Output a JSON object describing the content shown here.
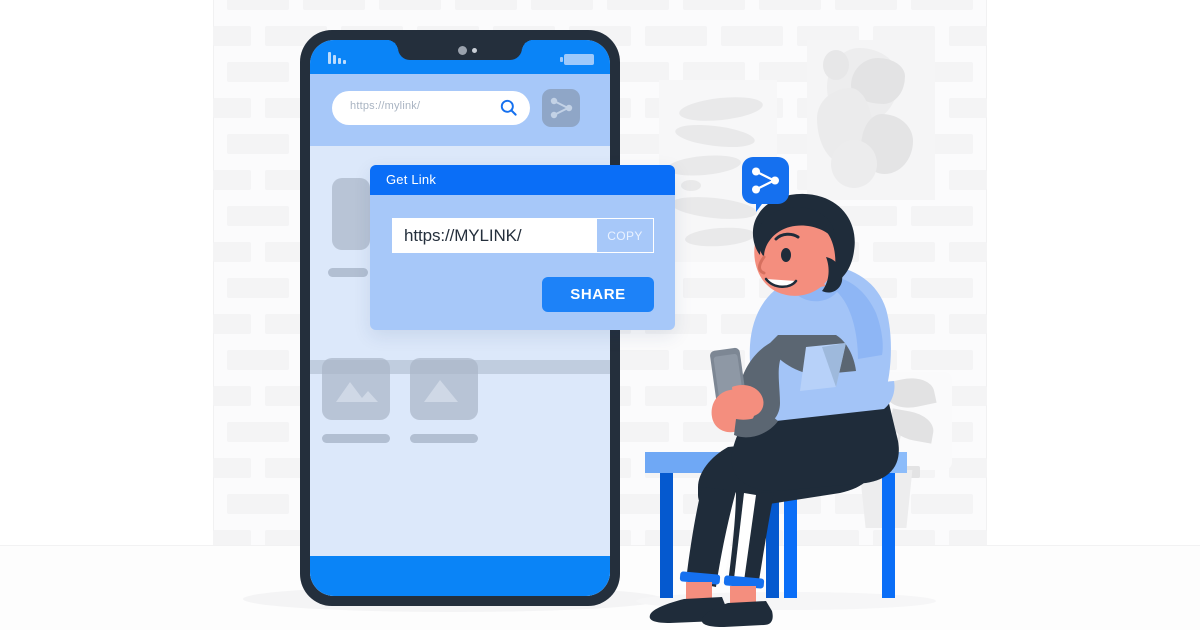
{
  "scene": {
    "title": "Share link illustration",
    "description": "Flat illustration of a woman sitting on a bench using her phone next to a large smartphone showing a Get Link share dialog"
  },
  "phone": {
    "status_bar": {
      "signal_icon": "signal-bars-icon",
      "signal_bars": 4,
      "battery_icon": "battery-icon",
      "camera_icon": "camera-dot-icon"
    },
    "search": {
      "placeholder": "https://mylink/",
      "search_icon": "search-icon",
      "share_icon": "share-nodes-icon"
    },
    "content_placeholders": [
      {
        "name": "image-card-left",
        "icon": "image-icon"
      },
      {
        "name": "image-card-right",
        "icon": "image-icon"
      },
      {
        "name": "text-line-left"
      },
      {
        "name": "text-line-right"
      }
    ],
    "home_indicator": "home-bar"
  },
  "dialog": {
    "title": "Get Link",
    "url_value": "https://MYLINK/",
    "copy_label": "COPY",
    "share_label": "SHARE"
  },
  "bubble": {
    "icon": "share-nodes-icon"
  },
  "bench": {
    "name": "park-bench",
    "legs": 4
  },
  "decor": {
    "framed_art": "abstract-art-frame",
    "squiggle_art": "squiggle-art-panel",
    "plant": "potted-plant",
    "wall": "brick-wall"
  },
  "colors": {
    "primary_blue": "#0a84f7",
    "deep_blue": "#0a6ef7",
    "light_blue": "#a7c8f9",
    "screen_blue": "#dce8fa",
    "dark_navy": "#1f2c3a",
    "skin": "#f48e7e",
    "gray_placeholder": "#b8c4d6",
    "white": "#ffffff"
  }
}
